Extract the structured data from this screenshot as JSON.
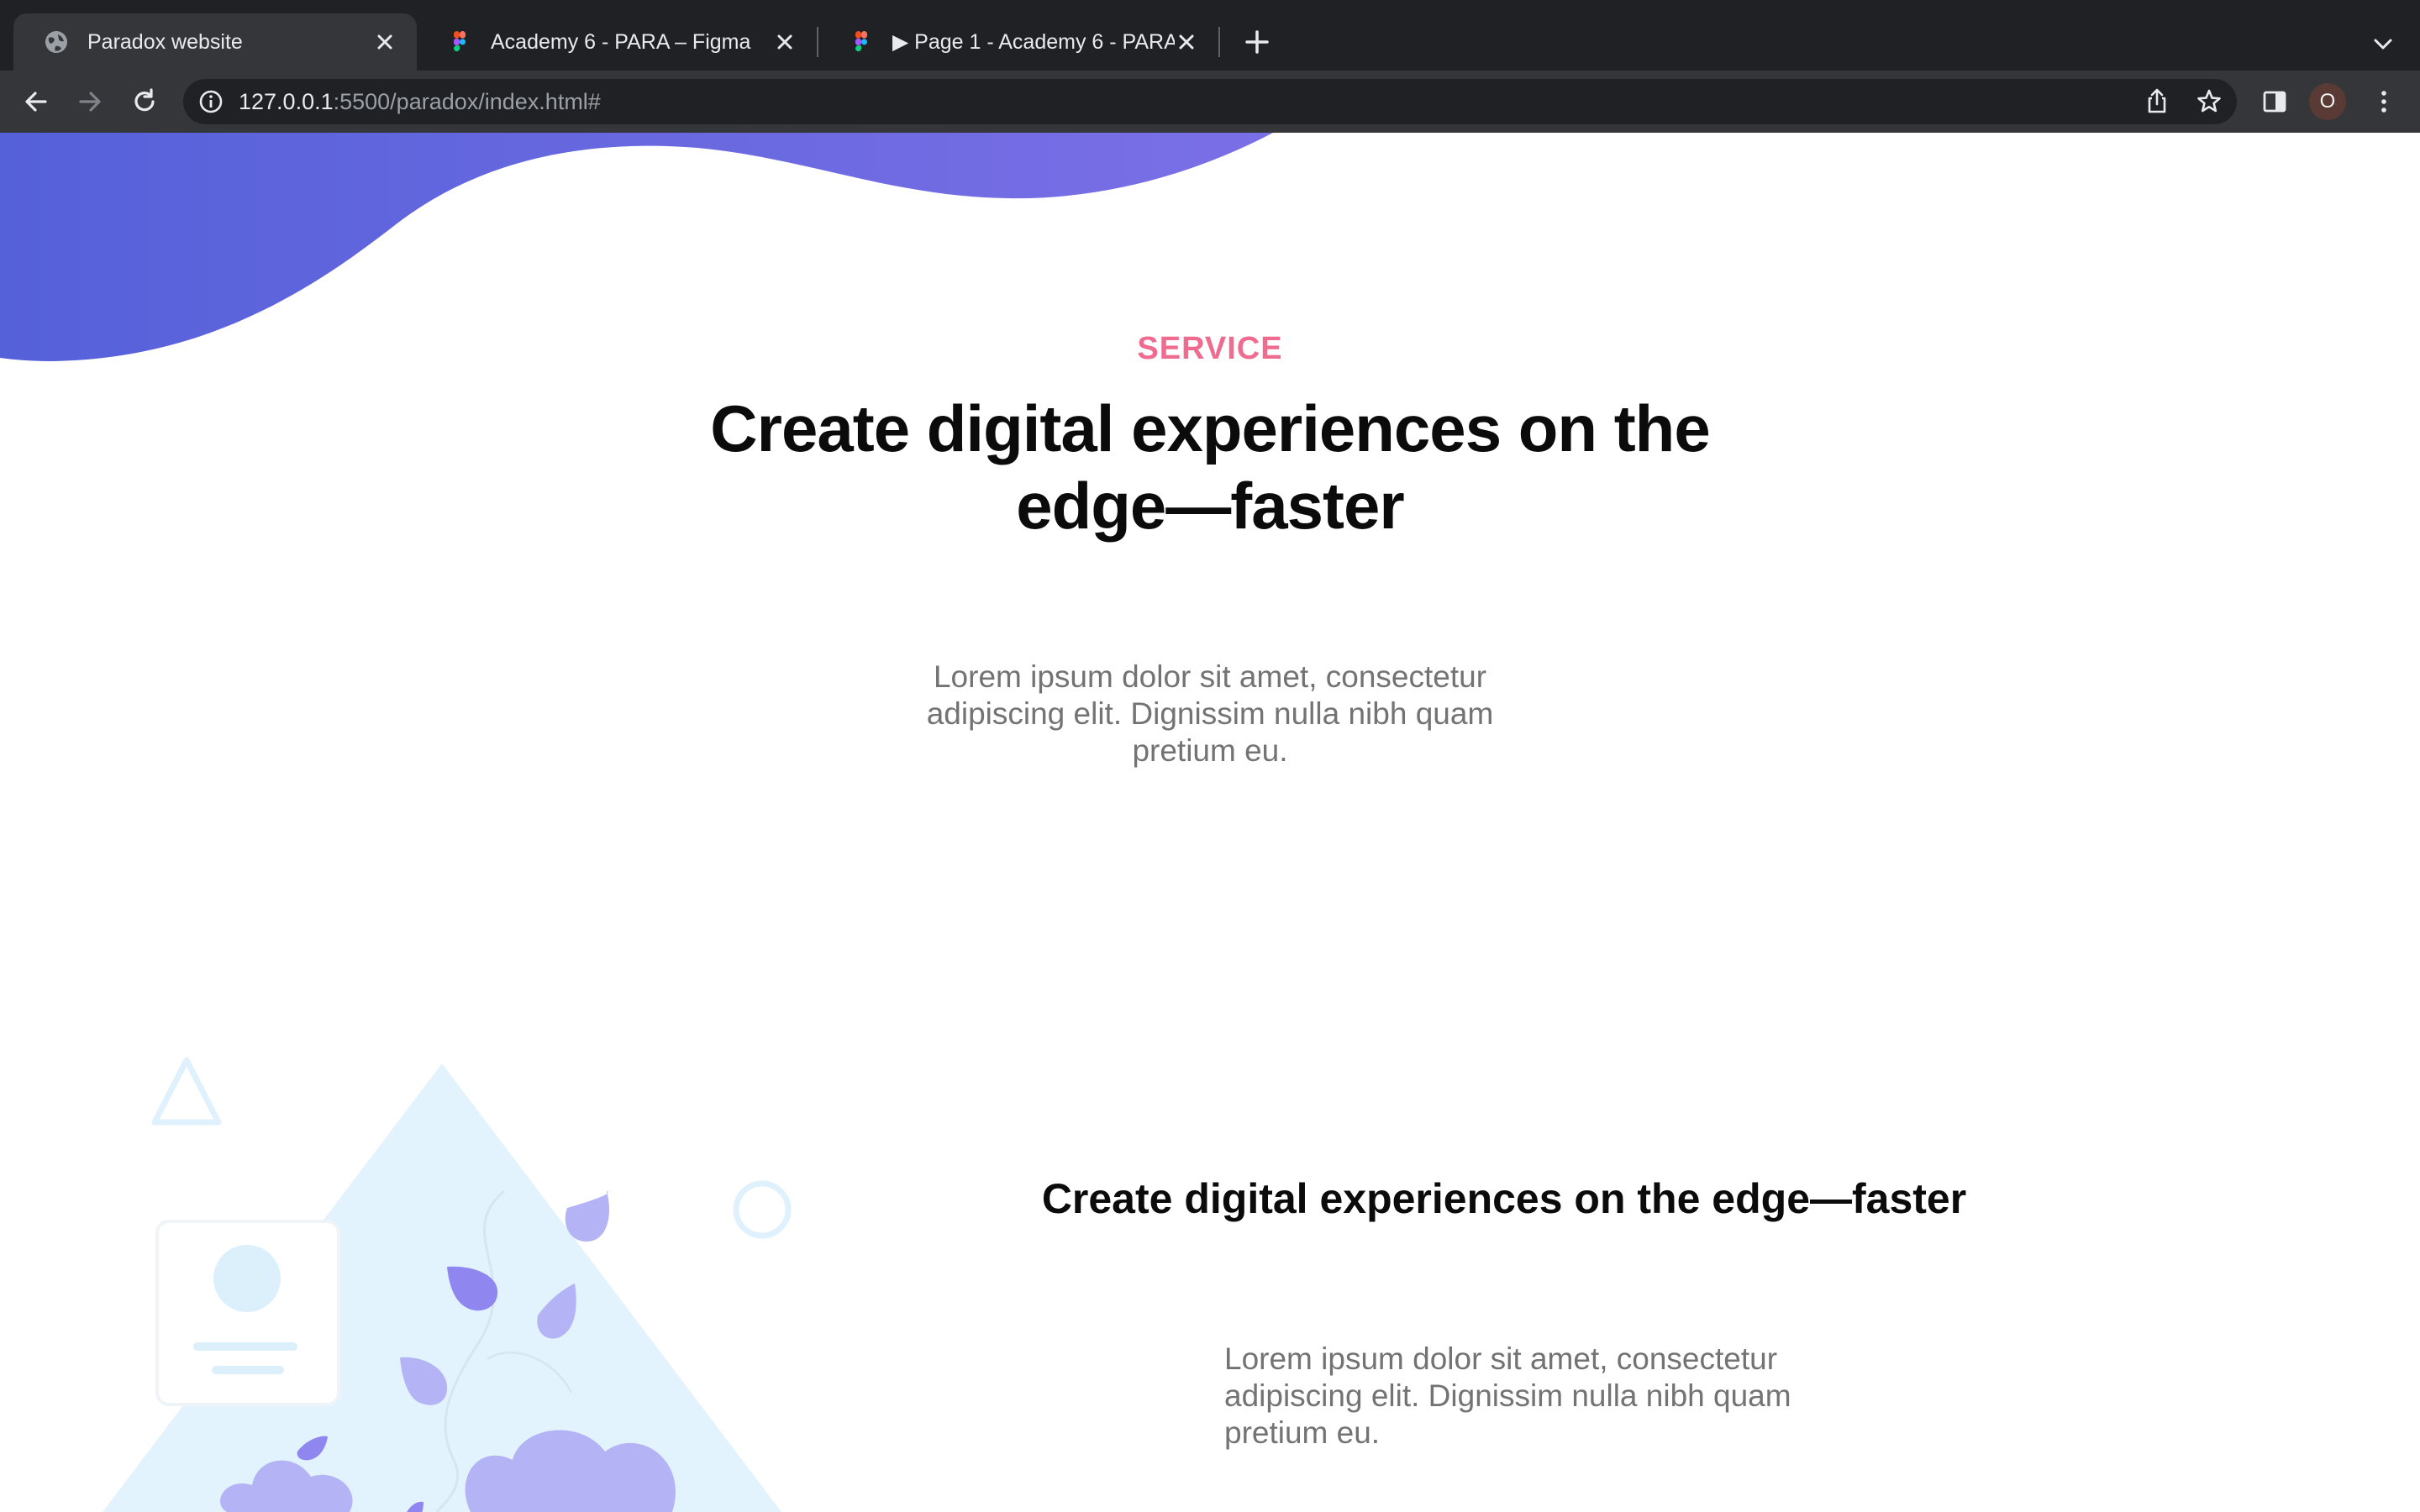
{
  "browser": {
    "tabs": [
      {
        "label": "Paradox website",
        "icon": "globe-icon",
        "active": true
      },
      {
        "label": "Academy 6 - PARA – Figma",
        "icon": "figma-icon",
        "active": false
      },
      {
        "label": "▶ Page 1 - Academy 6 - PARA",
        "icon": "figma-icon",
        "active": false
      }
    ],
    "url": {
      "host": "127.0.0.1",
      "rest": ":5500/paradox/index.html#"
    },
    "profile_initial": "O"
  },
  "page": {
    "eyebrow": "SERVICE",
    "headline": "Create digital experiences on the edge—faster",
    "intro": "Lorem ipsum dolor sit amet, consectetur adipiscing elit. Dignissim nulla nibh quam pretium eu.",
    "feature": {
      "title": "Create digital experiences on the edge—faster",
      "body": "Lorem ipsum dolor sit amet, consectetur adipiscing elit. Dignissim nulla nibh quam pretium eu."
    }
  },
  "colors": {
    "accent_pink": "#ef6b8f",
    "wave_gradient_start": "#5561d9",
    "wave_gradient_end": "#7b6fe6",
    "illustration_light_blue": "#e3f3fd",
    "illustration_purple": "#b3b3f5"
  }
}
